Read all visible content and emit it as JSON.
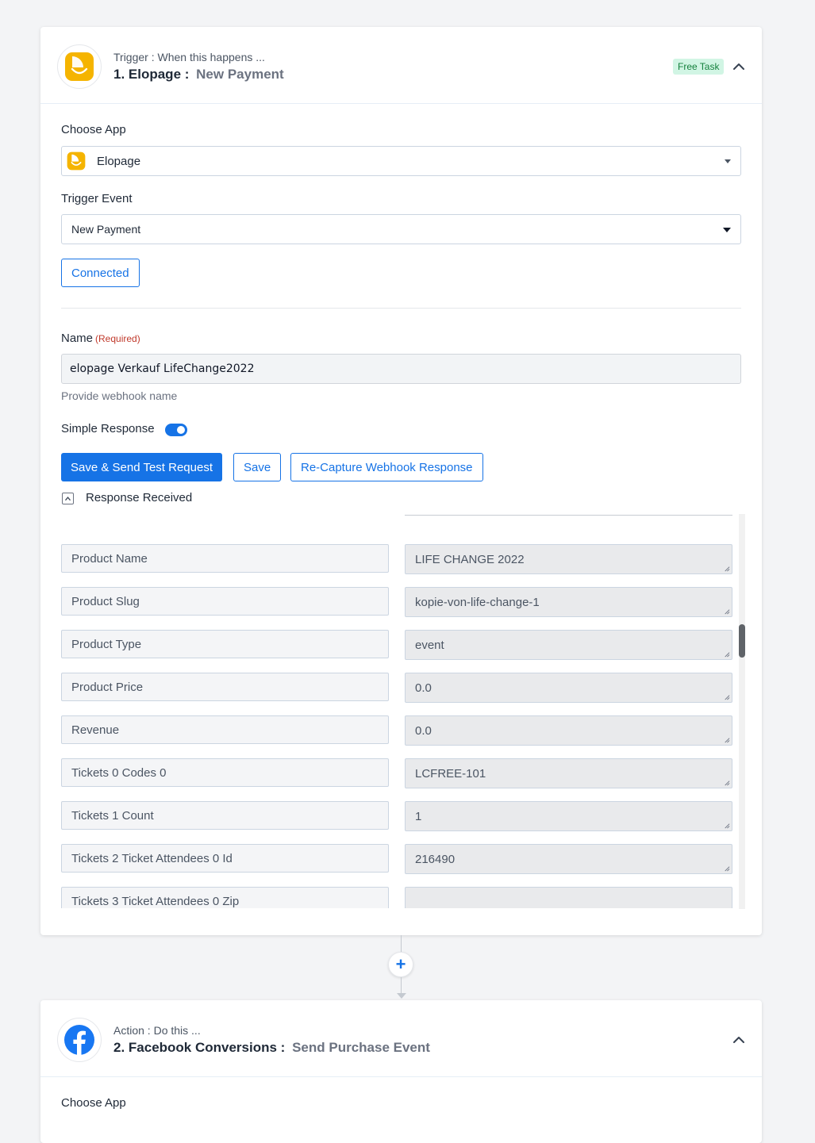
{
  "trigger": {
    "subtitle": "Trigger : When this happens ...",
    "title": "1. Elopage :",
    "event": "New Payment",
    "badge": "Free Task",
    "choose_app_label": "Choose App",
    "app_value": "Elopage",
    "trigger_event_label": "Trigger Event",
    "trigger_event_value": "New Payment",
    "connected_label": "Connected",
    "name_label": "Name",
    "name_required": "(Required)",
    "name_value": "elopage Verkauf LifeChange2022",
    "name_helper": "Provide webhook name",
    "simple_response_label": "Simple Response",
    "save_send_label": "Save & Send Test Request",
    "save_label": "Save",
    "recapture_label": "Re-Capture Webhook Response",
    "response_received_label": "Response Received",
    "responses": [
      {
        "key": "Product Name",
        "value": "LIFE CHANGE 2022"
      },
      {
        "key": "Product Slug",
        "value": "kopie-von-life-change-1"
      },
      {
        "key": "Product Type",
        "value": "event"
      },
      {
        "key": "Product Price",
        "value": "0.0"
      },
      {
        "key": "Revenue",
        "value": "0.0"
      },
      {
        "key": "Tickets 0 Codes 0",
        "value": "LCFREE-101"
      },
      {
        "key": "Tickets 1 Count",
        "value": "1"
      },
      {
        "key": "Tickets 2 Ticket Attendees 0 Id",
        "value": "216490"
      },
      {
        "key": "Tickets 3 Ticket Attendees 0 Zip",
        "value": ""
      }
    ]
  },
  "action": {
    "subtitle": "Action : Do this ...",
    "title": "2. Facebook Conversions :",
    "event": "Send Purchase Event",
    "choose_app_label": "Choose App"
  },
  "connector": {
    "plus": "+"
  },
  "colors": {
    "accent": "#1673e6",
    "elopage": "#f5b400",
    "facebook": "#1877f2",
    "badge_bg": "#d1f5e4"
  }
}
